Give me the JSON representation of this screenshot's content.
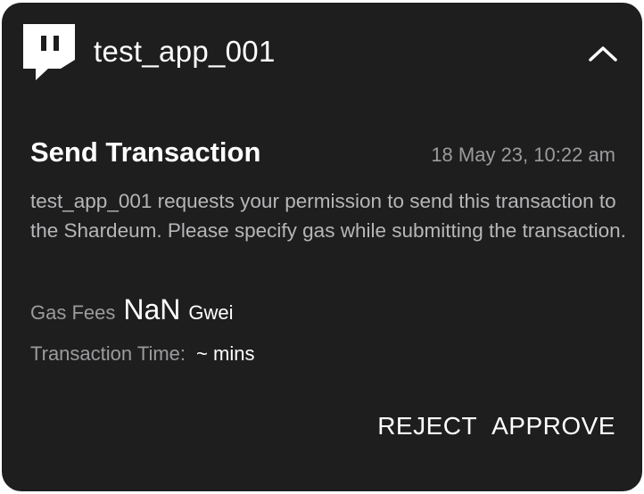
{
  "header": {
    "app_name": "test_app_001",
    "app_icon": "twitch-logo-icon",
    "collapse_icon": "chevron-up-icon"
  },
  "transaction": {
    "title": "Send Transaction",
    "timestamp": "18 May 23, 10:22 am",
    "message": "test_app_001 requests your permission to send this transaction to the Shardeum. Please specify gas while submitting the transaction.",
    "gas_label": "Gas Fees",
    "gas_value": "NaN",
    "gas_unit": "Gwei",
    "time_label": "Transaction Time:",
    "time_value": "~ mins"
  },
  "actions": {
    "reject_label": "REJECT",
    "approve_label": "APPROVE"
  },
  "colors": {
    "card_background": "#1e1e1f",
    "primary_text": "#ffffff",
    "secondary_text": "#9b9b9d"
  }
}
